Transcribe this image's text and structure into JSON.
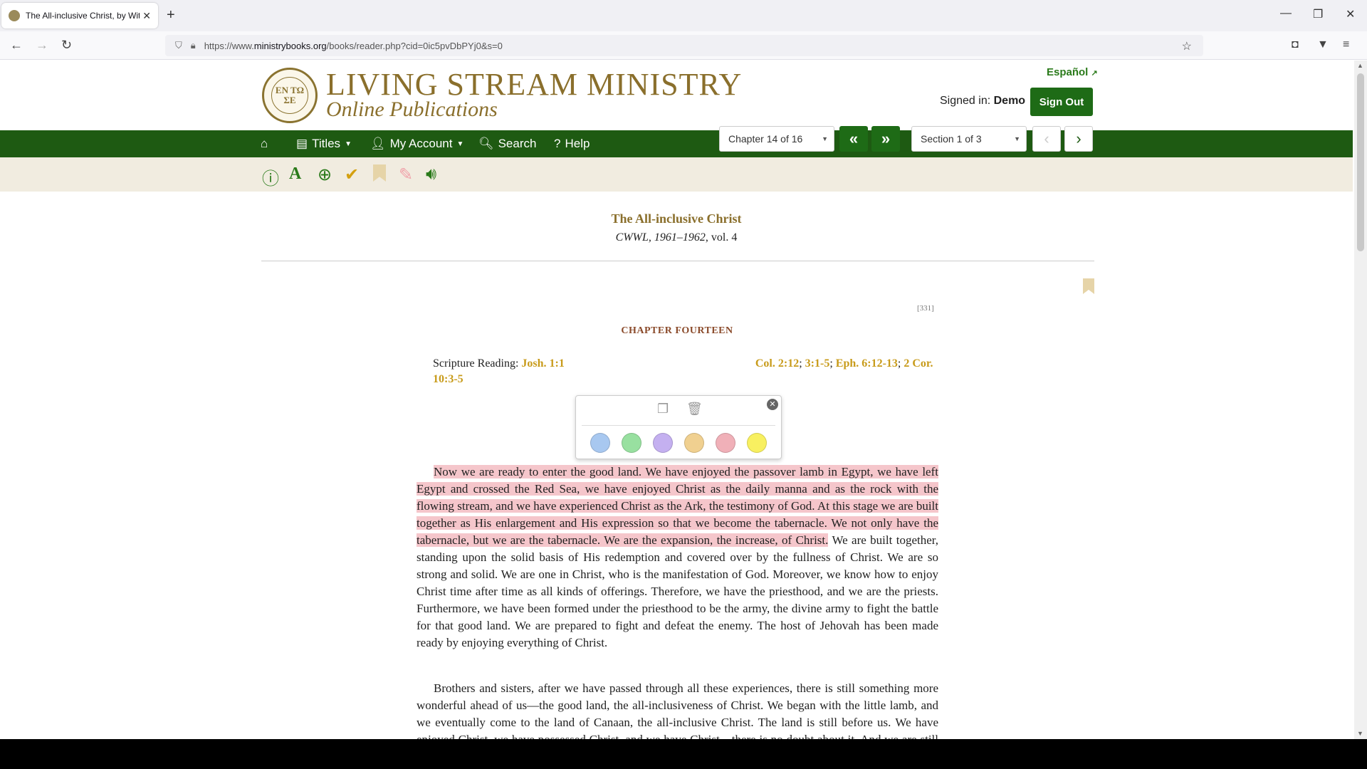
{
  "browser": {
    "tab_title": "The All-inclusive Christ, by Witn",
    "new_tab": "+",
    "url_prefix": "https://www.",
    "url_domain": "ministrybooks.org",
    "url_path": "/books/reader.php?cid=0ic5pvDbPYj0&s=0"
  },
  "header": {
    "title": "LIVING STREAM MINISTRY",
    "subtitle": "Online Publications",
    "seal_text": "EN TΩ ΣE",
    "espanol": "Español",
    "signed_in_label": "Signed in:",
    "signed_in_user": "Demo",
    "sign_out": "Sign Out"
  },
  "nav": {
    "titles": "Titles",
    "my_account": "My Account",
    "search": "Search",
    "help": "Help"
  },
  "reader": {
    "chapter_select": "Chapter 14 of 16",
    "section_select": "Section 1 of 3"
  },
  "book": {
    "title": "The All-inclusive Christ",
    "series": "CWWL, 1961–1962",
    "volume": ", vol. 4",
    "page_number": "[331]",
    "chapter_heading": "CHAPTER FOURTEEN",
    "scripture_label": "Scripture Reading:",
    "scripture_refs": [
      "Josh. 1:1",
      "Col. 2:12",
      "3:1-5",
      "Eph. 6:12-13",
      "2 Cor. 10:3-5"
    ],
    "p1_highlighted": "Now we are ready to enter the good land. We have enjoyed the passover lamb in Egypt, we have left Egypt and crossed the Red Sea, we have enjoyed Christ as the daily manna and as the rock with the flowing stream, and we have experienced Christ as the Ark, the testimony of God. At this stage we are built together as His enlargement and His expression so that we become the tabernacle. We not only have the tabernacle, but we are the tabernacle. We are the expansion, the increase, of Christ.",
    "p1_rest": " We are built together, standing upon the solid basis of His redemption and covered over by the fullness of Christ. We are so strong and solid. We are one in Christ, who is the manifestation of God. Moreover, we know how to enjoy Christ time after time as all kinds of offerings. Therefore, we have the priesthood, and we are the priests. Furthermore, we have been formed under the priesthood to be the army, the divine army to fight the battle for that good land. We are prepared to fight and defeat the enemy. The host of Jehovah has been made ready by enjoying everything of Christ.",
    "p2": "Brothers and sisters, after we have passed through all these experiences, there is still something more wonderful ahead of us—the good land, the all-inclusiveness of Christ. We began with the little lamb, and we eventually come to the land of Canaan, the all-inclusive Christ. The land is still before us. We have enjoyed Christ, we have possessed Christ, and we have Christ—there is no doubt about it. And we are still enjoying Christ. Yet ahead of us is more of Christ. A much greater Christ is waiting to be possessed, for the goal God has set before us is the all-inclusive Christ. We must not stop short of the goal."
  },
  "highlight_popup": {
    "colors": [
      "#a8c8f0",
      "#98e0a0",
      "#c4b0f0",
      "#f0d090",
      "#f0b0b8",
      "#f8f060"
    ]
  },
  "colors": {
    "green": "#1e5a12",
    "gold": "#8a6f2c",
    "highlight_pink": "#f5c6cb",
    "ref_gold": "#c89b1a"
  }
}
